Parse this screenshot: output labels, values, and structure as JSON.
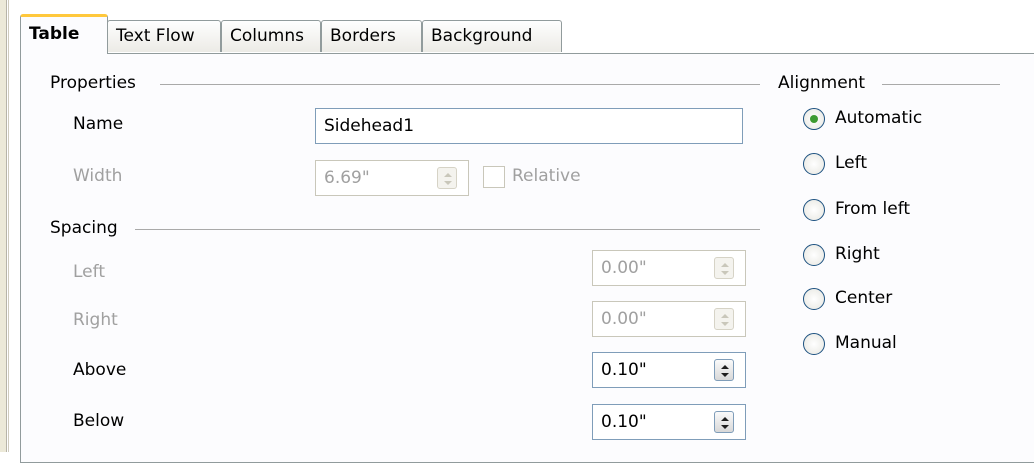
{
  "tabs": [
    {
      "label": "Table",
      "active": true
    },
    {
      "label": "Text Flow",
      "active": false
    },
    {
      "label": "Columns",
      "active": false
    },
    {
      "label": "Borders",
      "active": false
    },
    {
      "label": "Background",
      "active": false
    }
  ],
  "properties": {
    "title": "Properties",
    "name_label": "Name",
    "name_value": "Sidehead1",
    "width_label": "Width",
    "width_value": "6.69\"",
    "relative_label": "Relative"
  },
  "spacing": {
    "title": "Spacing",
    "left_label": "Left",
    "left_value": "0.00\"",
    "right_label": "Right",
    "right_value": "0.00\"",
    "above_label": "Above",
    "above_value": "0.10\"",
    "below_label": "Below",
    "below_value": "0.10\""
  },
  "alignment": {
    "title": "Alignment",
    "options": [
      {
        "label": "Automatic",
        "selected": true
      },
      {
        "label": "Left",
        "selected": false
      },
      {
        "label": "From left",
        "selected": false
      },
      {
        "label": "Right",
        "selected": false
      },
      {
        "label": "Center",
        "selected": false
      },
      {
        "label": "Manual",
        "selected": false
      }
    ]
  },
  "colors": {
    "active_tab_accent": "#ffc83c",
    "radio_selected": "#3c9a31",
    "disabled_text": "#a0a0a0"
  }
}
